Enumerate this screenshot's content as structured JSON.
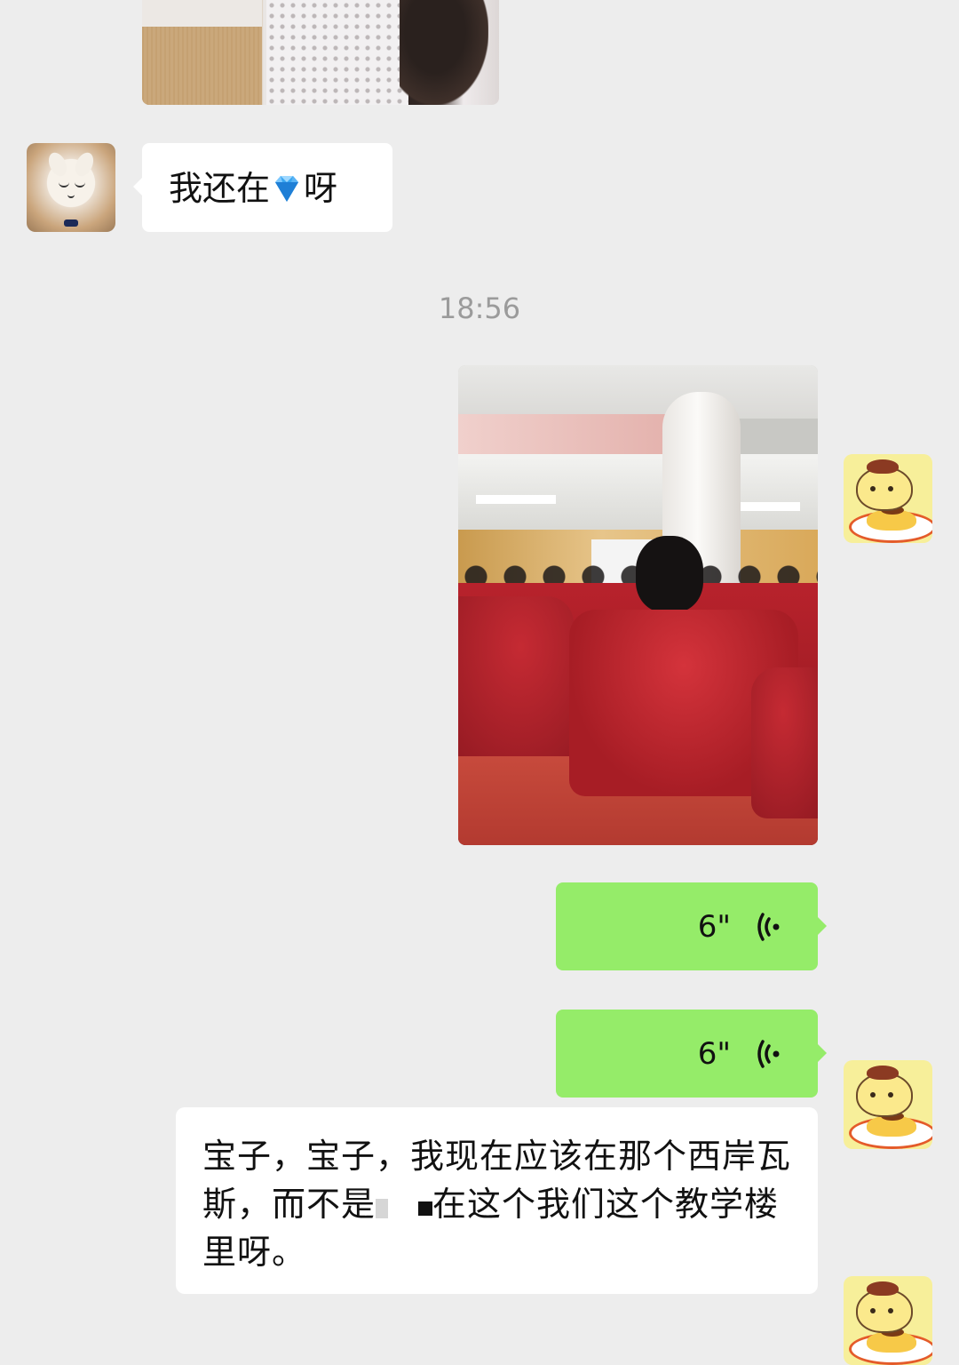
{
  "messages": {
    "incoming_text_before": "我还在",
    "incoming_text_after": "呀",
    "incoming_emoji": "gem-emoji",
    "timestamp": "18:56",
    "voice_1_duration": "6\"",
    "voice_2_duration": "6\"",
    "transcript_part1": "宝子，宝子，我现在应该在那个西岸瓦斯，而不是",
    "transcript_part2": "在这个我们这个教学楼里呀。"
  },
  "icons": {
    "voice": "voice-wave-icon",
    "emoji": "gem-icon"
  },
  "colors": {
    "background": "#ededed",
    "bubble_incoming": "#ffffff",
    "bubble_outgoing": "#95ec69",
    "timestamp": "#9b9b9b"
  }
}
